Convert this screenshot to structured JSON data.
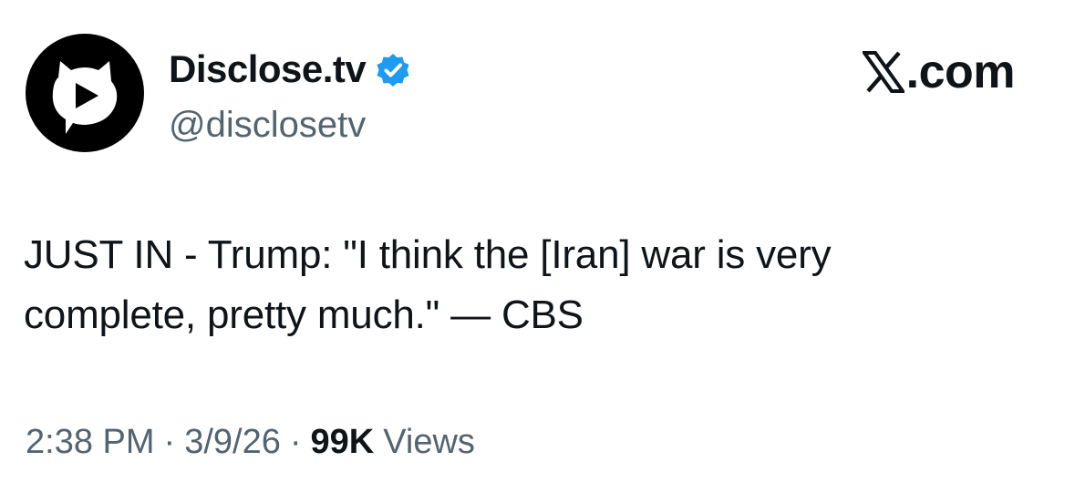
{
  "author": {
    "display_name": "Disclose.tv",
    "handle": "@disclosetv",
    "verified": true,
    "avatar_icon": "disclosetv-play-logo",
    "verified_icon": "verified-badge-icon",
    "verified_color": "#1d9bf0"
  },
  "source": {
    "icon": "x-logo-icon",
    "label": ".com"
  },
  "tweet": {
    "line_1": "JUST IN - Trump: \"I think the [Iran] war is very",
    "line_2": "complete, pretty much.\" — CBS"
  },
  "meta": {
    "time": "2:38 PM",
    "separator": "·",
    "date": "3/9/26",
    "views_count": "99K",
    "views_label": "Views"
  },
  "colors": {
    "text_primary": "#0f1419",
    "text_secondary": "#536471",
    "background": "#ffffff"
  }
}
